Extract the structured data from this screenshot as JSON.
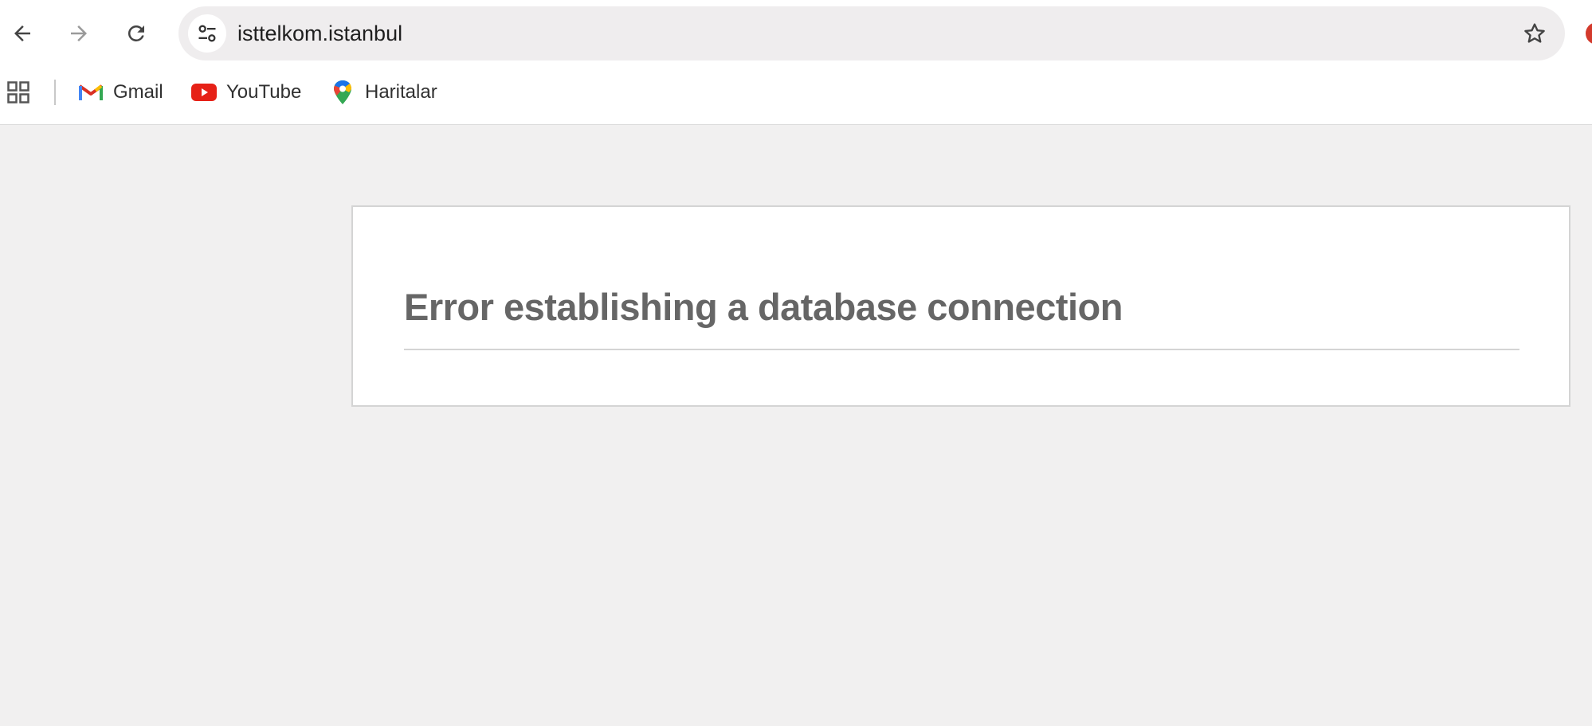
{
  "toolbar": {
    "back_icon": "arrow-left-icon",
    "forward_icon": "arrow-right-icon",
    "reload_icon": "reload-icon",
    "site_info_icon": "tune-icon",
    "url": "isttelkom.istanbul",
    "bookmark_star_icon": "star-icon"
  },
  "bookmarks": {
    "apps_icon": "apps-grid-icon",
    "items": [
      {
        "label": "Gmail",
        "icon": "gmail-icon"
      },
      {
        "label": "YouTube",
        "icon": "youtube-icon"
      },
      {
        "label": "Haritalar",
        "icon": "maps-pin-icon"
      }
    ]
  },
  "page": {
    "error_title": "Error establishing a database connection"
  },
  "colors": {
    "page_background": "#f1f0f0",
    "box_background": "#ffffff",
    "title_text": "#666666",
    "youtube_red": "#e62117"
  }
}
